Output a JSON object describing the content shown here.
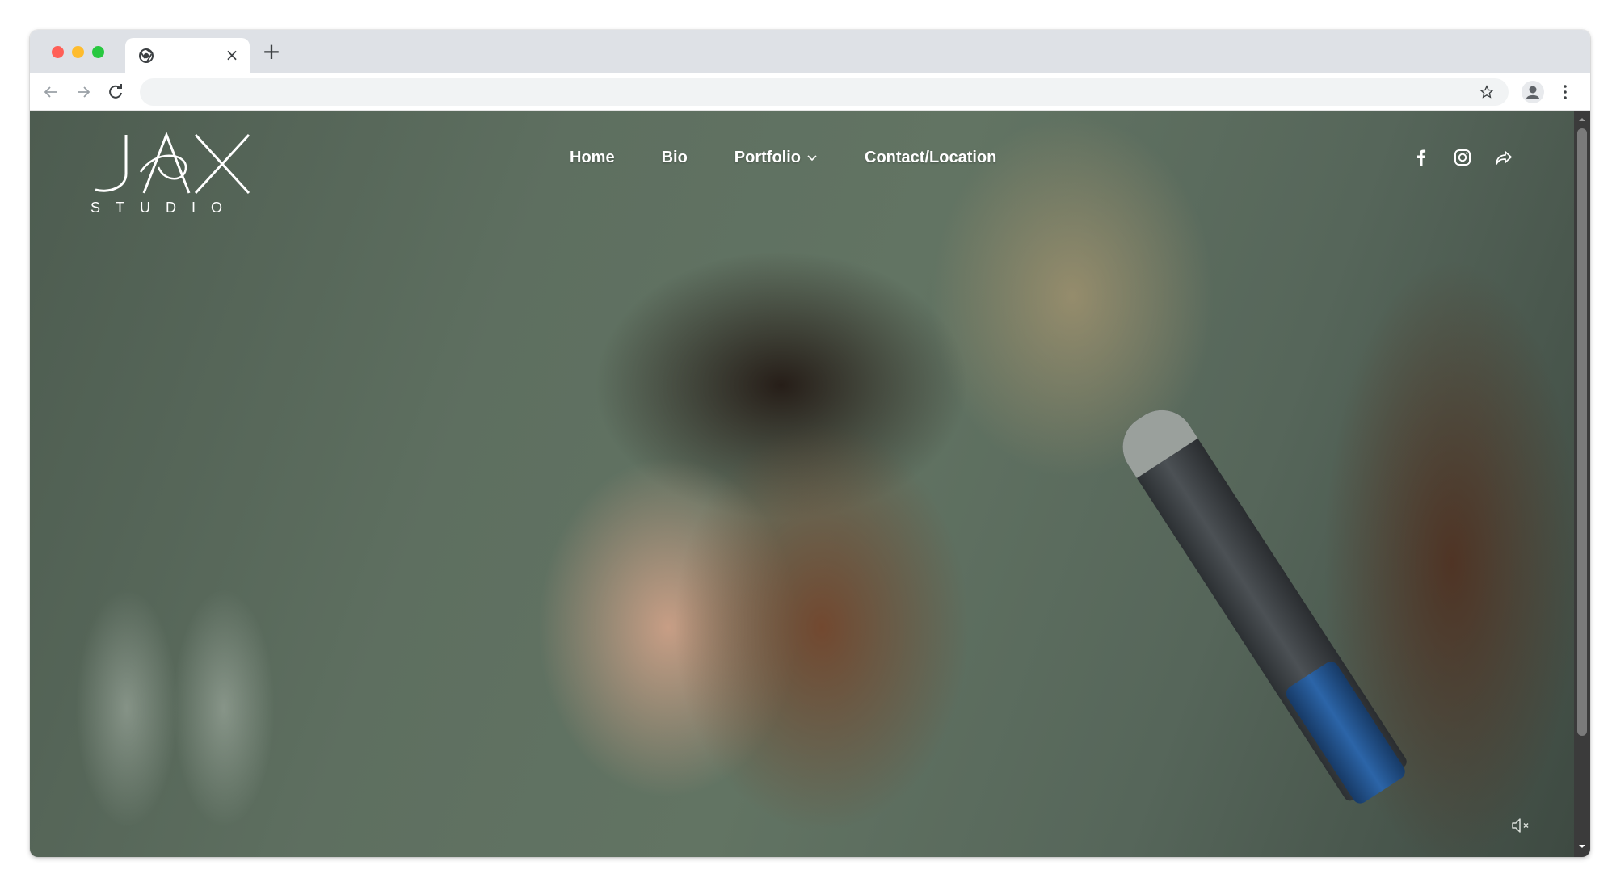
{
  "browser": {
    "tab_title": "",
    "tab_close_glyph": "×",
    "new_tab_glyph": "+",
    "address_bar": {
      "value": "",
      "placeholder": ""
    },
    "icons": [
      "back-arrow-icon",
      "forward-arrow-icon",
      "reload-icon",
      "bookmark-star-icon",
      "profile-icon",
      "kebab-menu-icon"
    ]
  },
  "site": {
    "logo": {
      "mark": "JAX",
      "subtitle": "STUDIO"
    },
    "nav": {
      "items": [
        {
          "label": "Home"
        },
        {
          "label": "Bio"
        },
        {
          "label": "Portfolio",
          "has_dropdown": true
        },
        {
          "label": "Contact/Location"
        }
      ]
    },
    "social_icons": [
      "facebook-icon",
      "instagram-icon",
      "share-icon"
    ],
    "hero": {
      "video_muted": true
    },
    "colors": {
      "nav_text": "#ffffff",
      "hero_tone": "#5e6f60"
    }
  }
}
